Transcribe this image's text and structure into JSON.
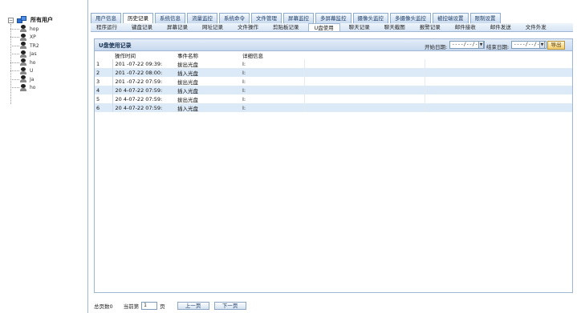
{
  "tree": {
    "root_label": "所有用户",
    "toggle": "−",
    "users": [
      "hop",
      "XP",
      "TR2",
      "Jas",
      "ho",
      "U",
      "Ja",
      "ho"
    ]
  },
  "tabs_primary": [
    {
      "label": "用户信息",
      "active": false
    },
    {
      "label": "历史记录",
      "active": true
    },
    {
      "label": "系统信息",
      "active": false
    },
    {
      "label": "流量监控",
      "active": false
    },
    {
      "label": "系统命令",
      "active": false
    },
    {
      "label": "文件管理",
      "active": false
    },
    {
      "label": "屏幕监控",
      "active": false
    },
    {
      "label": "多屏幕监控",
      "active": false
    },
    {
      "label": "摄像头监控",
      "active": false
    },
    {
      "label": "多摄像头监控",
      "active": false
    },
    {
      "label": "被控端设置",
      "active": false
    },
    {
      "label": "限制设置",
      "active": false
    }
  ],
  "tabs_secondary": [
    {
      "label": "程序运行",
      "active": false
    },
    {
      "label": "键盘记录",
      "active": false
    },
    {
      "label": "屏幕记录",
      "active": false
    },
    {
      "label": "网址记录",
      "active": false
    },
    {
      "label": "文件操作",
      "active": false
    },
    {
      "label": "剪贴板记录",
      "active": false
    },
    {
      "label": "U盘使用",
      "active": true
    },
    {
      "label": "聊天记录",
      "active": false
    },
    {
      "label": "聊天截图",
      "active": false
    },
    {
      "label": "报警记录",
      "active": false
    },
    {
      "label": "邮件接收",
      "active": false
    },
    {
      "label": "邮件发送",
      "active": false
    },
    {
      "label": "文件外发",
      "active": false
    }
  ],
  "panel": {
    "title": "U盘使用记录",
    "start_label": "开始日期:",
    "start_value": "----/--/--",
    "end_label": "结束日期:",
    "end_value": "----/--/--",
    "dropdown_glyph": "▼",
    "export_label": "导出"
  },
  "table": {
    "headers": [
      "操作时间",
      "事件名称",
      "详细信息"
    ],
    "rows": [
      {
        "n": "1",
        "time": "201 -07-22 09:39:",
        "event": "拔出光盘",
        "detail": "I:"
      },
      {
        "n": "2",
        "time": "201 -07-22 08:00:",
        "event": "插入光盘",
        "detail": "I:"
      },
      {
        "n": "3",
        "time": "201 -07-22 07:59:",
        "event": "拔出光盘",
        "detail": "I:"
      },
      {
        "n": "4",
        "time": "20 4-07-22 07:59:",
        "event": "插入光盘",
        "detail": "I:"
      },
      {
        "n": "5",
        "time": "20 4-07-22 07:59:",
        "event": "拔出光盘",
        "detail": "I:"
      },
      {
        "n": "6",
        "time": "20 4-07-22 07:59:",
        "event": "插入光盘",
        "detail": "I:"
      }
    ]
  },
  "pager": {
    "total_label": "总页数0",
    "current_label": "当前第",
    "current_value": "1",
    "page_suffix": "页",
    "prev_label": "上一页",
    "next_label": "下一页"
  }
}
